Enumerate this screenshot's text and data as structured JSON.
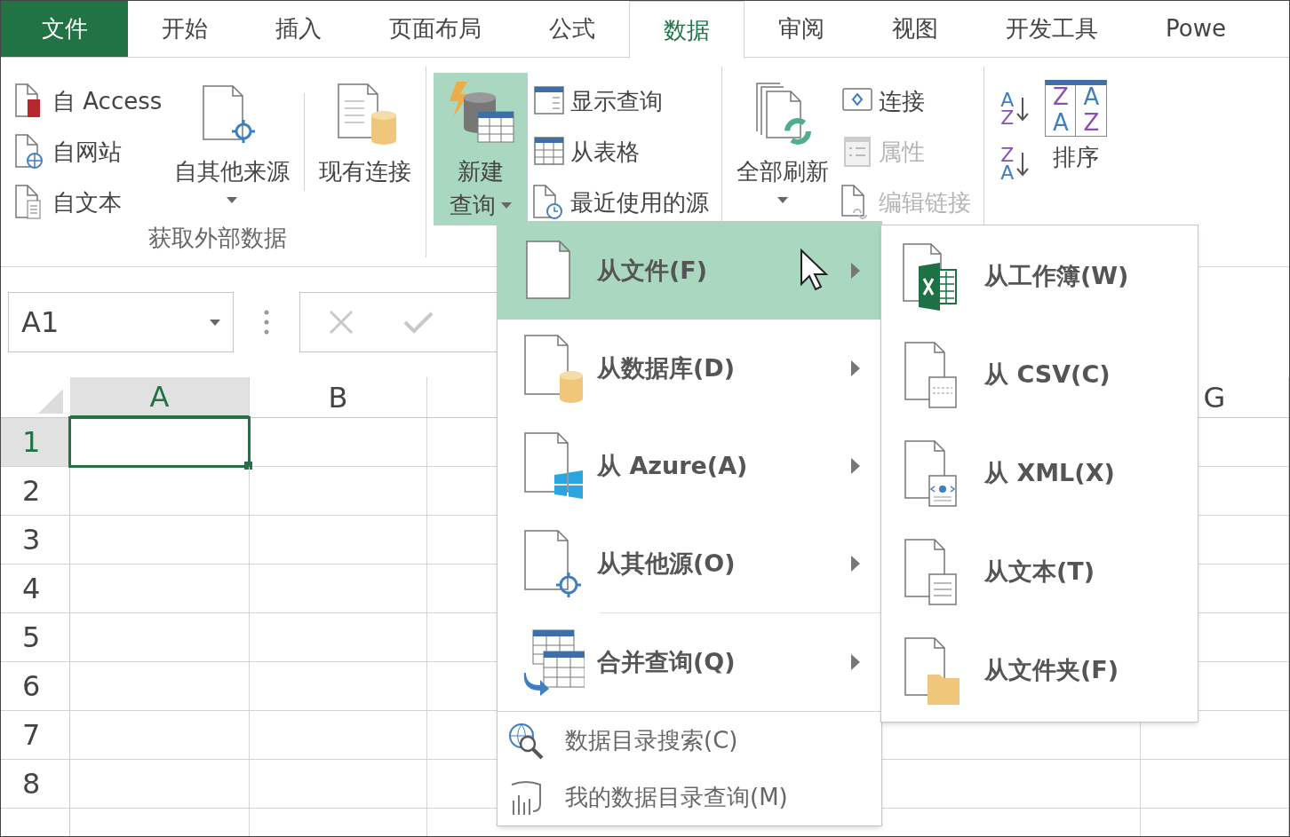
{
  "tabs": [
    {
      "label": "文件",
      "kind": "file",
      "selected": false
    },
    {
      "label": "开始",
      "kind": "tab",
      "selected": false
    },
    {
      "label": "插入",
      "kind": "tab",
      "selected": false
    },
    {
      "label": "页面布局",
      "kind": "tab",
      "selected": false
    },
    {
      "label": "公式",
      "kind": "tab",
      "selected": false
    },
    {
      "label": "数据",
      "kind": "tab",
      "selected": true
    },
    {
      "label": "审阅",
      "kind": "tab",
      "selected": false
    },
    {
      "label": "视图",
      "kind": "tab",
      "selected": false
    },
    {
      "label": "开发工具",
      "kind": "tab",
      "selected": false
    },
    {
      "label": "Powe",
      "kind": "tab",
      "selected": false
    }
  ],
  "ribbon": {
    "groups": [
      {
        "label": "获取外部数据",
        "controls": [
          {
            "kind": "stack",
            "items": [
              {
                "label": "自 Access",
                "disabled": false
              },
              {
                "label": "自网站",
                "disabled": false
              },
              {
                "label": "自文本",
                "disabled": false
              }
            ]
          },
          {
            "kind": "large",
            "label_lines": [
              "自其他来源"
            ],
            "dropdown": true,
            "selected": false
          },
          {
            "kind": "divider"
          },
          {
            "kind": "large",
            "label_lines": [
              "现有连接"
            ],
            "dropdown": false,
            "selected": false
          }
        ]
      },
      {
        "controls": [
          {
            "kind": "large",
            "label_lines": [
              "新建",
              "查询"
            ],
            "dropdown": true,
            "selected": true
          },
          {
            "kind": "stack",
            "items": [
              {
                "label": "显示查询",
                "disabled": false
              },
              {
                "label": "从表格",
                "disabled": false
              },
              {
                "label": "最近使用的源",
                "disabled": false
              }
            ]
          }
        ]
      },
      {
        "controls": [
          {
            "kind": "large",
            "label_lines": [
              "全部刷新"
            ],
            "dropdown": true,
            "selected": false
          },
          {
            "kind": "stack",
            "items": [
              {
                "label": "连接",
                "disabled": false
              },
              {
                "label": "属性",
                "disabled": true
              },
              {
                "label": "编辑链接",
                "disabled": true
              }
            ]
          }
        ]
      },
      {
        "controls": [
          {
            "kind": "sortstack",
            "items": [
              {
                "top": "A",
                "bottom": "Z"
              },
              {
                "top": "Z",
                "bottom": "A"
              }
            ]
          },
          {
            "kind": "large",
            "label_lines": [
              "排序"
            ],
            "glyphs": [
              "Z",
              "A",
              "A",
              "Z"
            ],
            "dropdown": false,
            "selected": false
          }
        ]
      }
    ]
  },
  "name_box": {
    "value": "A1"
  },
  "sheet": {
    "columns": [
      {
        "label": "A",
        "selected": true
      },
      {
        "label": "B",
        "selected": false
      },
      {
        "label": "G",
        "selected": false
      }
    ],
    "rows": [
      {
        "label": "1",
        "selected": true
      },
      {
        "label": "2",
        "selected": false
      },
      {
        "label": "3",
        "selected": false
      },
      {
        "label": "4",
        "selected": false
      },
      {
        "label": "5",
        "selected": false
      },
      {
        "label": "6",
        "selected": false
      },
      {
        "label": "7",
        "selected": false
      },
      {
        "label": "8",
        "selected": false
      }
    ]
  },
  "new_query_menu": {
    "items": [
      {
        "label": "从文件(F)",
        "selected": true,
        "submenu": true
      },
      {
        "label": "从数据库(D)",
        "selected": false,
        "submenu": true
      },
      {
        "label": "从 Azure(A)",
        "selected": false,
        "submenu": true
      },
      {
        "label": "从其他源(O)",
        "selected": false,
        "submenu": true
      },
      {
        "label": "合并查询(Q)",
        "selected": false,
        "submenu": true
      }
    ],
    "footer_items": [
      {
        "label": "数据目录搜索(C)"
      },
      {
        "label": "我的数据目录查询(M)"
      }
    ]
  },
  "file_submenu": {
    "items": [
      {
        "label": "从工作簿(W)"
      },
      {
        "label": "从 CSV(C)"
      },
      {
        "label": "从 XML(X)"
      },
      {
        "label": "从文本(T)"
      },
      {
        "label": "从文件夹(F)"
      }
    ]
  }
}
